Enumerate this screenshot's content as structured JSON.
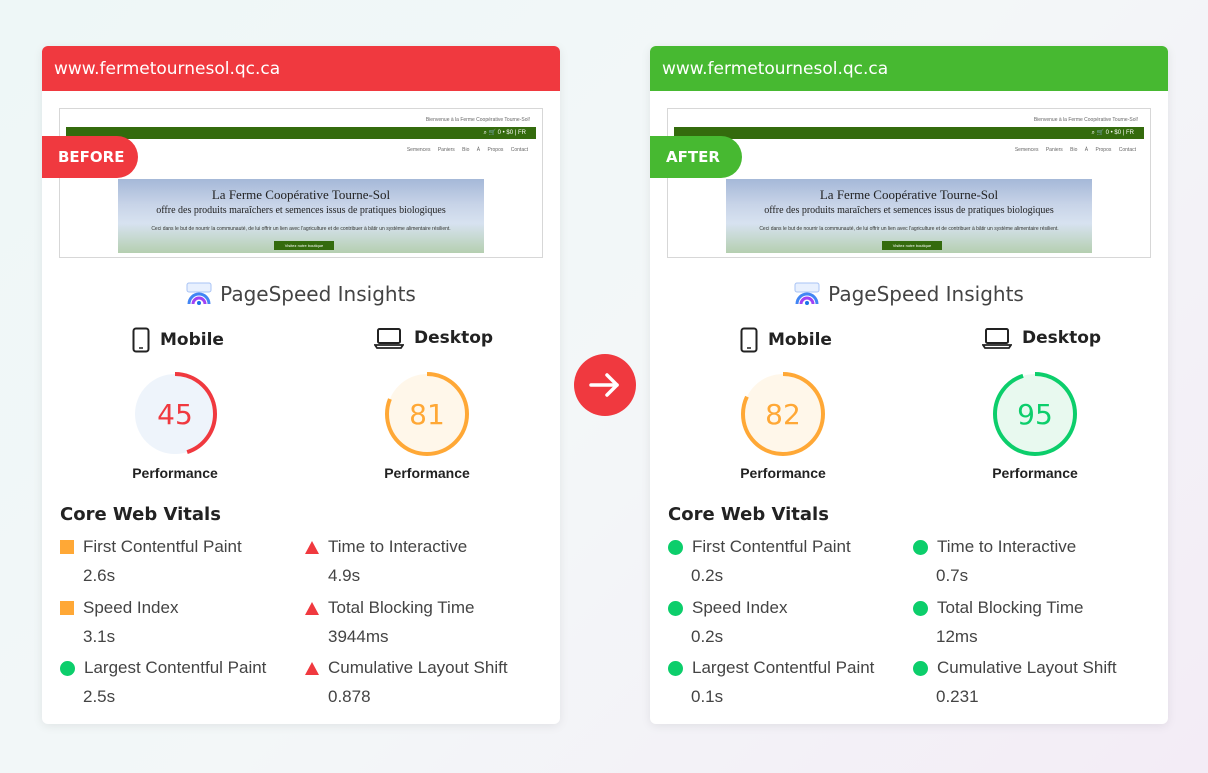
{
  "colors": {
    "before": "#f0393f",
    "after": "#47b931",
    "pass": "#0cce6b",
    "average": "#ffa836",
    "fail": "#f0393f"
  },
  "shared": {
    "site_url": "www.fermetournesol.qc.ca",
    "psi_title": "PageSpeed Insights",
    "mobile_label": "Mobile",
    "desktop_label": "Desktop",
    "performance_label": "Performance",
    "cwv_title": "Core Web Vitals",
    "preview": {
      "top_text": "Bienvenue à la Ferme Coopérative Tourne-Sol!",
      "cart_text": "0 • $0 | FR",
      "nav_text": "Semences Paniers Bio À Propos Contact",
      "heading": "La Ferme Coopérative Tourne-Sol",
      "subheading": "offre des produits maraîchers et semences issus de pratiques biologiques",
      "paragraph": "Ceci dans le but de nourrir la communauté, de lui offrir un lien avec l'agriculture et de contribuer à bâtir un système alimentaire résilient.",
      "button": "Visitez notre boutique"
    }
  },
  "before": {
    "tag": "BEFORE",
    "mobile_score": "45",
    "mobile_score_value": 45,
    "desktop_score": "81",
    "desktop_score_value": 81,
    "metrics": [
      {
        "name": "First Contentful Paint",
        "value": "2.6s",
        "status": "average"
      },
      {
        "name": "Time to Interactive",
        "value": "4.9s",
        "status": "fail"
      },
      {
        "name": "Speed Index",
        "value": "3.1s",
        "status": "average"
      },
      {
        "name": "Total Blocking Time",
        "value": "3944ms",
        "status": "fail"
      },
      {
        "name": "Largest Contentful Paint",
        "value": "2.5s",
        "status": "pass"
      },
      {
        "name": "Cumulative Layout Shift",
        "value": "0.878",
        "status": "fail"
      }
    ]
  },
  "after": {
    "tag": "AFTER",
    "mobile_score": "82",
    "mobile_score_value": 82,
    "desktop_score": "95",
    "desktop_score_value": 95,
    "metrics": [
      {
        "name": "First Contentful Paint",
        "value": "0.2s",
        "status": "pass"
      },
      {
        "name": "Time to Interactive",
        "value": "0.7s",
        "status": "pass"
      },
      {
        "name": "Speed Index",
        "value": "0.2s",
        "status": "pass"
      },
      {
        "name": "Total Blocking Time",
        "value": "12ms",
        "status": "pass"
      },
      {
        "name": "Largest Contentful Paint",
        "value": "0.1s",
        "status": "pass"
      },
      {
        "name": "Cumulative Layout Shift",
        "value": "0.231",
        "status": "pass"
      }
    ]
  },
  "arrow_icon": "arrow-right-icon"
}
